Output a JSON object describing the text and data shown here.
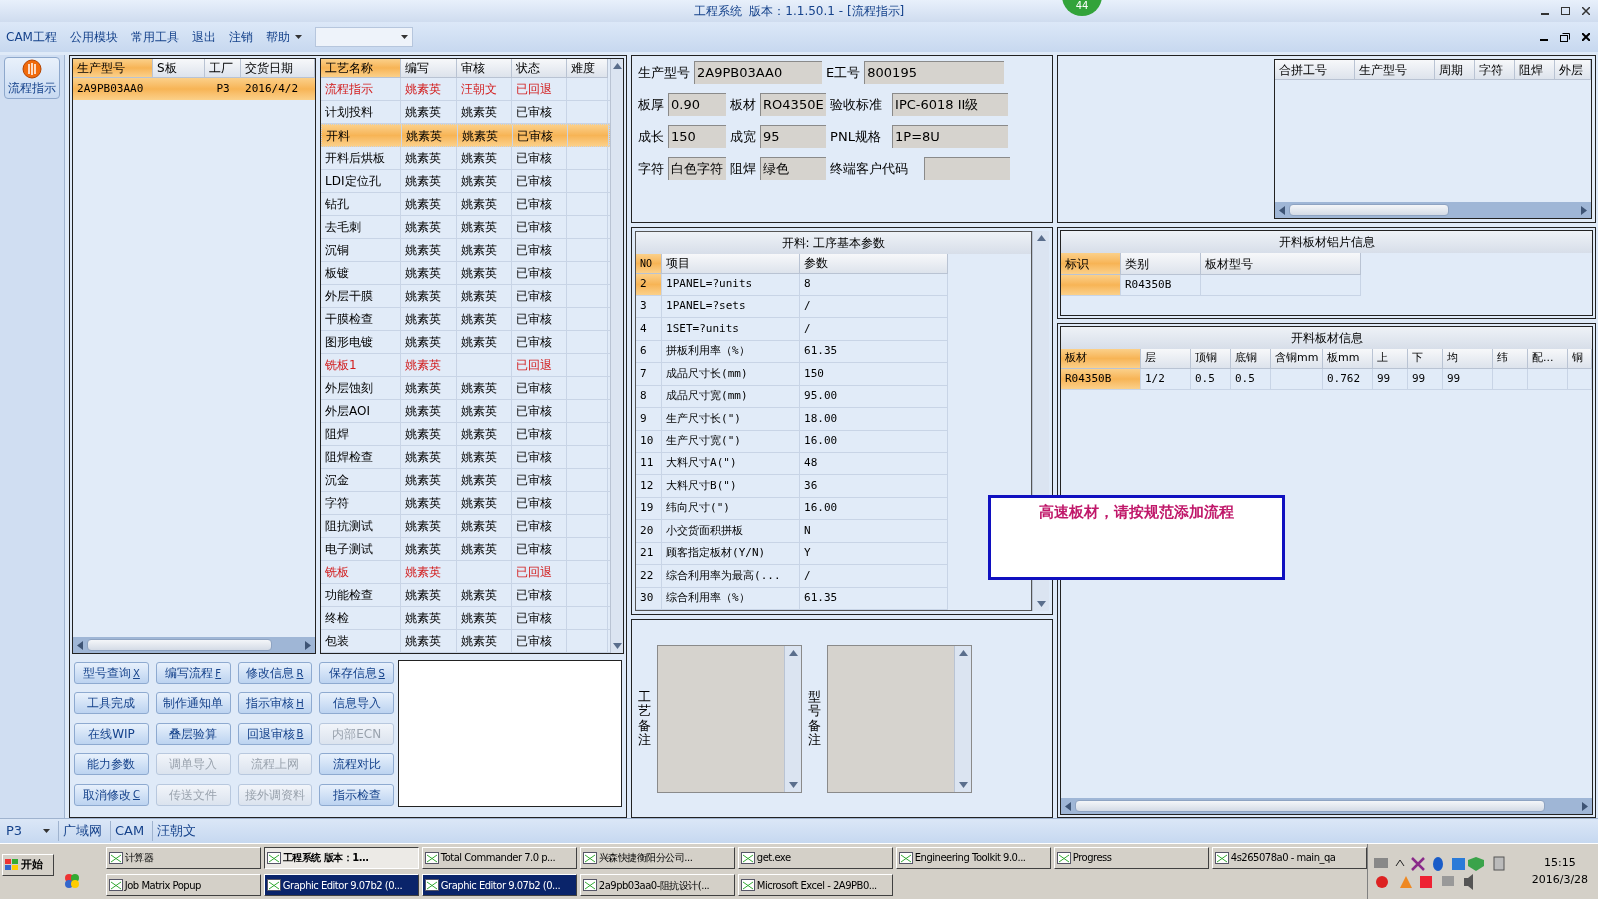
{
  "title_bar": {
    "title": "工程系统  版本：1.1.50.1 - [流程指示]",
    "badge": "44"
  },
  "menu": {
    "items": [
      "CAM工程",
      "公用模块",
      "常用工具",
      "退出",
      "注销",
      "帮助"
    ]
  },
  "side_toolbar": {
    "button": "流程指示"
  },
  "orders": {
    "columns": [
      "生产型号",
      "S板",
      "工厂",
      "交货日期"
    ],
    "rows": [
      {
        "cells": [
          "2A9PB03AA0",
          null,
          "P3",
          "2016/4/2"
        ],
        "selected": true
      }
    ]
  },
  "process": {
    "columns": [
      "工艺名称",
      "编写",
      "审核",
      "状态",
      "难度"
    ],
    "rows": [
      {
        "cells": [
          "流程指示",
          "姚素英",
          "汪朝文",
          "已回退"
        ],
        "returned": true,
        "selected": false
      },
      {
        "cells": [
          "计划投料",
          "姚素英",
          "姚素英",
          "已审核"
        ],
        "returned": false,
        "selected": false
      },
      {
        "cells": [
          "开料",
          "姚素英",
          "姚素英",
          "已审核"
        ],
        "returned": false,
        "selected": true
      },
      {
        "cells": [
          "开料后烘板",
          "姚素英",
          "姚素英",
          "已审核"
        ],
        "returned": false,
        "selected": false
      },
      {
        "cells": [
          "LDI定位孔",
          "姚素英",
          "姚素英",
          "已审核"
        ],
        "returned": false,
        "selected": false
      },
      {
        "cells": [
          "钻孔",
          "姚素英",
          "姚素英",
          "已审核"
        ],
        "returned": false,
        "selected": false
      },
      {
        "cells": [
          "去毛刺",
          "姚素英",
          "姚素英",
          "已审核"
        ],
        "returned": false,
        "selected": false
      },
      {
        "cells": [
          "沉铜",
          "姚素英",
          "姚素英",
          "已审核"
        ],
        "returned": false,
        "selected": false
      },
      {
        "cells": [
          "板镀",
          "姚素英",
          "姚素英",
          "已审核"
        ],
        "returned": false,
        "selected": false
      },
      {
        "cells": [
          "外层干膜",
          "姚素英",
          "姚素英",
          "已审核"
        ],
        "returned": false,
        "selected": false
      },
      {
        "cells": [
          "干膜检查",
          "姚素英",
          "姚素英",
          "已审核"
        ],
        "returned": false,
        "selected": false
      },
      {
        "cells": [
          "图形电镀",
          "姚素英",
          "姚素英",
          "已审核"
        ],
        "returned": false,
        "selected": false
      },
      {
        "cells": [
          "铣板1",
          "姚素英",
          null,
          "已回退"
        ],
        "returned": true,
        "selected": false
      },
      {
        "cells": [
          "外层蚀刻",
          "姚素英",
          "姚素英",
          "已审核"
        ],
        "returned": false,
        "selected": false
      },
      {
        "cells": [
          "外层AOI",
          "姚素英",
          "姚素英",
          "已审核"
        ],
        "returned": false,
        "selected": false
      },
      {
        "cells": [
          "阻焊",
          "姚素英",
          "姚素英",
          "已审核"
        ],
        "returned": false,
        "selected": false
      },
      {
        "cells": [
          "阻焊检查",
          "姚素英",
          "姚素英",
          "已审核"
        ],
        "returned": false,
        "selected": false
      },
      {
        "cells": [
          "沉金",
          "姚素英",
          "姚素英",
          "已审核"
        ],
        "returned": false,
        "selected": false
      },
      {
        "cells": [
          "字符",
          "姚素英",
          "姚素英",
          "已审核"
        ],
        "returned": false,
        "selected": false
      },
      {
        "cells": [
          "阻抗测试",
          "姚素英",
          "姚素英",
          "已审核"
        ],
        "returned": false,
        "selected": false
      },
      {
        "cells": [
          "电子测试",
          "姚素英",
          "姚素英",
          "已审核"
        ],
        "returned": false,
        "selected": false
      },
      {
        "cells": [
          "铣板",
          "姚素英",
          null,
          "已回退"
        ],
        "returned": true,
        "selected": false
      },
      {
        "cells": [
          "功能检查",
          "姚素英",
          "姚素英",
          "已审核"
        ],
        "returned": false,
        "selected": false
      },
      {
        "cells": [
          "终检",
          "姚素英",
          "姚素英",
          "已审核"
        ],
        "returned": false,
        "selected": false
      },
      {
        "cells": [
          "包装",
          "姚素英",
          "姚素英",
          "已审核"
        ],
        "returned": false,
        "selected": false
      }
    ]
  },
  "actions": [
    {
      "label": "型号查询",
      "shortcut": "X",
      "disabled": false
    },
    {
      "label": "编写流程",
      "shortcut": "F",
      "disabled": false
    },
    {
      "label": "修改信息",
      "shortcut": "R",
      "disabled": false
    },
    {
      "label": "保存信息",
      "shortcut": "S",
      "disabled": false
    },
    {
      "label": "工具完成",
      "disabled": false
    },
    {
      "label": "制作通知单",
      "disabled": false
    },
    {
      "label": "指示审核",
      "shortcut": "H",
      "disabled": false
    },
    {
      "label": "信息导入",
      "disabled": false
    },
    {
      "label": "在线WIP",
      "disabled": false
    },
    {
      "label": "叠层验算",
      "disabled": false
    },
    {
      "label": "回退审核",
      "shortcut": "B",
      "disabled": false
    },
    {
      "label": "内部ECN",
      "disabled": true
    },
    {
      "label": "能力参数",
      "disabled": false
    },
    {
      "label": "调单导入",
      "disabled": true
    },
    {
      "label": "流程上网",
      "disabled": true
    },
    {
      "label": "流程对比",
      "disabled": false
    },
    {
      "label": "取消修改",
      "shortcut": "C",
      "disabled": false
    },
    {
      "label": "传送文件",
      "disabled": true
    },
    {
      "label": "接外调资料",
      "disabled": true
    },
    {
      "label": "指示检查",
      "disabled": false
    }
  ],
  "info_fields": [
    [
      {
        "label": "生产型号",
        "value": "2A9PB03AA0"
      },
      {
        "label": "E工号",
        "value": "800195"
      }
    ],
    [
      {
        "label": "板厚",
        "value": "0.90"
      },
      {
        "label": "板材",
        "value": "RO4350E"
      },
      {
        "label": "验收标准",
        "value": "IPC-6018 II级"
      }
    ],
    [
      {
        "label": "成长",
        "value": "150"
      },
      {
        "label": "成宽",
        "value": "95"
      },
      {
        "label": "PNL规格",
        "value": "1P=8U"
      }
    ],
    [
      {
        "label": "字符",
        "value": "白色字符"
      },
      {
        "label": "阻焊",
        "value": "绿色"
      },
      {
        "label": "终端客户代码"
      }
    ]
  ],
  "params": {
    "title": "开料: 工序基本参数",
    "columns": [
      "NO",
      "项目",
      "参数"
    ],
    "rows": [
      {
        "no": "2",
        "item": "1PANEL=?units",
        "value": "8",
        "selected": true
      },
      {
        "no": "3",
        "item": "1PANEL=?sets",
        "value": "/",
        "selected": false
      },
      {
        "no": "4",
        "item": "1SET=?units",
        "value": "/",
        "selected": false
      },
      {
        "no": "6",
        "item": "拼板利用率（%）",
        "value": "61.35",
        "selected": false
      },
      {
        "no": "7",
        "item": "成品尺寸长(mm)",
        "value": "150",
        "selected": false
      },
      {
        "no": "8",
        "item": "成品尺寸宽(mm)",
        "value": "95.00",
        "selected": false
      },
      {
        "no": "9",
        "item": "生产尺寸长(\")",
        "value": "18.00",
        "selected": false
      },
      {
        "no": "10",
        "item": "生产尺寸宽(\")",
        "value": "16.00",
        "selected": false
      },
      {
        "no": "11",
        "item": "大料尺寸A(\")",
        "value": "48",
        "selected": false
      },
      {
        "no": "12",
        "item": "大料尺寸B(\")",
        "value": "36",
        "selected": false
      },
      {
        "no": "19",
        "item": "纬向尺寸(\")",
        "value": "16.00",
        "selected": false
      },
      {
        "no": "20",
        "item": "小交货面积拼板",
        "value": "N",
        "selected": false
      },
      {
        "no": "21",
        "item": "顾客指定板材(Y/N)",
        "value": "Y",
        "selected": false
      },
      {
        "no": "22",
        "item": "综合利用率为最高(...",
        "value": "/",
        "selected": false
      },
      {
        "no": "30",
        "item": "综合利用率（%）",
        "value": "61.35",
        "selected": false
      }
    ]
  },
  "remarks": [
    "工艺备注",
    "型号备注"
  ],
  "merge_grid": {
    "columns": [
      "合拼工号",
      "生产型号",
      "周期",
      "字符",
      "阻焊",
      "外层"
    ]
  },
  "aluminum": {
    "title": "开料板材铝片信息",
    "columns": [
      "标识",
      "类别",
      "板材型号"
    ],
    "rows": [
      {
        "cells": [
          null,
          "R04350B",
          null
        ]
      }
    ]
  },
  "board": {
    "title": "开料板材信息",
    "columns": [
      "板材",
      "层",
      "顶铜",
      "底铜",
      "含铜mm",
      "板mm",
      "上",
      "下",
      "均",
      "纬",
      "配...",
      "铜"
    ],
    "rows": [
      {
        "cells": [
          "R04350B",
          "1/2",
          "0.5",
          "0.5",
          null,
          "0.762",
          "99",
          "99",
          "99",
          null,
          null,
          null
        ]
      }
    ]
  },
  "popup": {
    "message": "高速板材，请按规范添加流程"
  },
  "status_bar": {
    "plant": "P3",
    "items": [
      "广域网",
      "CAM",
      "汪朝文"
    ]
  },
  "taskbar": {
    "start": "开始",
    "rows": [
      [
        {
          "label": "计算器",
          "selected": false,
          "flashing": false
        },
        {
          "label": "工程系统  版本：1...",
          "selected": true,
          "flashing": false
        },
        {
          "label": "Total Commander 7.0 p...",
          "selected": false,
          "flashing": false
        },
        {
          "label": "兴森快捷衡阳分公司...",
          "selected": false,
          "flashing": false
        },
        {
          "label": "get.exe",
          "selected": false,
          "flashing": false
        },
        {
          "label": "Engineering Toolkit 9.0...",
          "selected": false,
          "flashing": false
        },
        {
          "label": "Progress",
          "selected": false,
          "flashing": false
        },
        {
          "label": "4s265078a0 - main_qa",
          "selected": false,
          "flashing": false
        }
      ],
      [
        {
          "label": "Job Matrix Popup",
          "selected": false,
          "flashing": false
        },
        {
          "label": "Graphic Editor 9.07b2 (0...",
          "selected": false,
          "flashing": true
        },
        {
          "label": "Graphic Editor 9.07b2 (0...",
          "selected": false,
          "flashing": true
        },
        {
          "label": "2a9pb03aa0-阻抗设计(...",
          "selected": false,
          "flashing": false
        },
        {
          "label": "Microsoft Excel - 2A9PB0...",
          "selected": false,
          "flashing": false
        }
      ]
    ],
    "clock": {
      "time": "15:15",
      "date": "2016/3/28"
    }
  }
}
